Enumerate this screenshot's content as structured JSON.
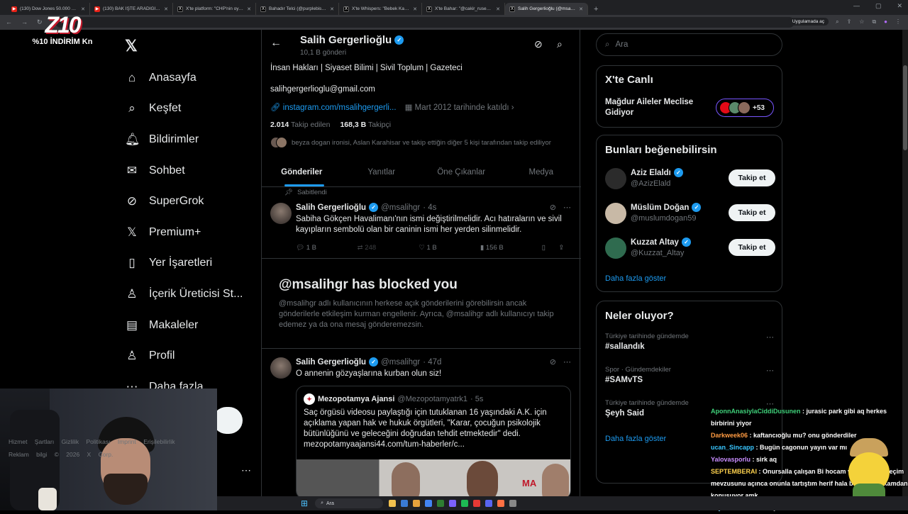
{
  "browser": {
    "tabs": [
      {
        "title": "(130) Dow Jones 50.000 Oldu",
        "kind": "yt"
      },
      {
        "title": "(130) BAK İŞTE ARADIĞIM OYU",
        "kind": "yt"
      },
      {
        "title": "X'te platform: \"CHP'nin oyunla",
        "kind": "x"
      },
      {
        "title": "Bahadır Telci (@purplebiss) / X",
        "kind": "x"
      },
      {
        "title": "X'te Whispers: \"Bebek Katili Ab",
        "kind": "x"
      },
      {
        "title": "X'te Bahar: \"@cakir_rusen @Ka",
        "kind": "x"
      },
      {
        "title": "Salih Gergerlioğlu (@msalihgr",
        "kind": "x"
      }
    ],
    "apps_label": "Uygulamada aç"
  },
  "stream": {
    "logo": "Z10",
    "discount": "%10 İNDİRİM Kn"
  },
  "nav": {
    "items": [
      {
        "label": "Anasayfa",
        "icon": "home-icon",
        "glyph": "⌂"
      },
      {
        "label": "Keşfet",
        "icon": "search-icon",
        "glyph": "⌕"
      },
      {
        "label": "Bildirimler",
        "icon": "bell-icon",
        "glyph": "🔔︎"
      },
      {
        "label": "Sohbet",
        "icon": "mail-icon",
        "glyph": "✉"
      },
      {
        "label": "SuperGrok",
        "icon": "grok-icon",
        "glyph": "⊘"
      },
      {
        "label": "Premium+",
        "icon": "x-logo-icon",
        "glyph": "𝕏"
      },
      {
        "label": "Yer İşaretleri",
        "icon": "bookmark-icon",
        "glyph": "▯"
      },
      {
        "label": "İçerik Üreticisi St...",
        "icon": "creator-icon",
        "glyph": "♙"
      },
      {
        "label": "Makaleler",
        "icon": "article-icon",
        "glyph": "▤"
      },
      {
        "label": "Profil",
        "icon": "person-icon",
        "glyph": "♙"
      },
      {
        "label": "Daha fazla",
        "icon": "more-icon",
        "glyph": "⋯"
      }
    ]
  },
  "profile": {
    "name": "Salih Gergerlioğlu",
    "post_count": "10,1 B gönderi",
    "bio": "İnsan Hakları | Siyaset Bilimi | Sivil Toplum | Gazeteci",
    "email": "salihgergerlioglu@gmail.com",
    "link": "instagram.com/msalihgergerli...",
    "joined": "Mart 2012 tarihinde katıldı",
    "following_count": "2.014",
    "following_label": "Takip edilen",
    "followers_count": "168,3 B",
    "followers_label": "Takipçi",
    "mutuals": "beyza dogan ironisi, Aslan Karahisar ve takip ettiğin diğer 5 kişi tarafından takip ediliyor"
  },
  "tabs": [
    "Gönderiler",
    "Yanıtlar",
    "Öne Çıkanlar",
    "Medya"
  ],
  "pinned_post": {
    "pinned_label": "Sabitlendi",
    "author": "Salih Gergerlioğlu",
    "handle": "@msalihgr",
    "time": "· 4s",
    "text": "Sabiha Gökçen Havalimanı'nın ismi değiştirilmelidir. Acı hatıraların ve sivil kayıpların sembolü olan bir caninin ismi her yerden silinmelidir.",
    "replies": "1 B",
    "reposts": "248",
    "likes": "1 B",
    "views": "156 B"
  },
  "blocked": {
    "title": "@msalihgr has blocked you",
    "text": "@msalihgr adlı kullanıcının herkese açık gönderilerini görebilirsin ancak gönderilerle etkileşim kurman engellenir. Ayrıca, @msalihgr adlı kullanıcıyı takip edemez ya da ona mesaj gönderemezsin."
  },
  "second_post": {
    "author": "Salih Gergerlioğlu",
    "handle": "@msalihgr",
    "time": "· 47d",
    "text": "O annenin gözyaşlarına kurban olun siz!",
    "quote": {
      "author": "Mezopotamya Ajansi",
      "handle": "@Mezopotamyatrk1",
      "time": "· 5s",
      "text": "Saç örgüsü videosu paylaştığı için tutuklanan 16 yaşındaki A.K. için açıklama yapan hak ve hukuk örgütleri, \"Karar, çocuğun psikolojik bütünlüğünü ve geleceğini doğrudan tehdit etmektedir\" dedi. mezopotamyaajansi44.com/tum-haberler/c...",
      "image_brand": "MA"
    }
  },
  "right": {
    "search_placeholder": "Ara",
    "live_title": "X'te Canlı",
    "live_event": "Mağdur Aileler Meclise Gidiyor",
    "live_count": "+53",
    "suggest_title": "Bunları beğenebilirsin",
    "suggestions": [
      {
        "name": "Aziz Elaldı",
        "handle": "@AzizElald",
        "button": "Takip et"
      },
      {
        "name": "Müslüm Doğan",
        "handle": "@muslumdogan59",
        "button": "Takip et"
      },
      {
        "name": "Kuzzat Altay",
        "handle": "@Kuzzat_Altay",
        "button": "Takip et"
      }
    ],
    "show_more": "Daha fazla göster",
    "trends_title": "Neler oluyor?",
    "trends": [
      {
        "context": "Türkiye tarihinde gündemde",
        "topic": "#sallandık"
      },
      {
        "context": "Spor · Gündemdekiler",
        "topic": "#SAMvTS"
      },
      {
        "context": "Türkiye tarihinde gündemde",
        "topic": "Şeyh Said"
      }
    ],
    "trends_more": "Daha fazla göster",
    "footer": "Hizmet Şartları Gizlilik Politikası Imprint Erişilebilirlik Reklam bilgi © 2026 X Corp."
  },
  "chat": [
    {
      "user": "AponnAnasiylaCiddiDusunen",
      "msg": "jurasic park gibi aq herkes birbirini yiyor"
    },
    {
      "user": "Darkweek06",
      "msg": "kaftancıoğlu mu? onu gönderdiler"
    },
    {
      "user": "ucan_Sincapp",
      "msg": "Bugün cagonun yayın var mı"
    },
    {
      "user": "Yalovasporlu",
      "msg": "sirk aq"
    },
    {
      "user": "SEPTEMBERAI",
      "msg": "Onursalla çalışan Bi hocam vardı gerste seçim mevzusunu açınca onunla tartıştım herif hala bölümde arkamdan konuşuyor amk"
    },
    {
      "user": "Vayzs",
      "msg": "bunları konuştularmı"
    }
  ],
  "taskbar": {
    "search": "Ara"
  }
}
